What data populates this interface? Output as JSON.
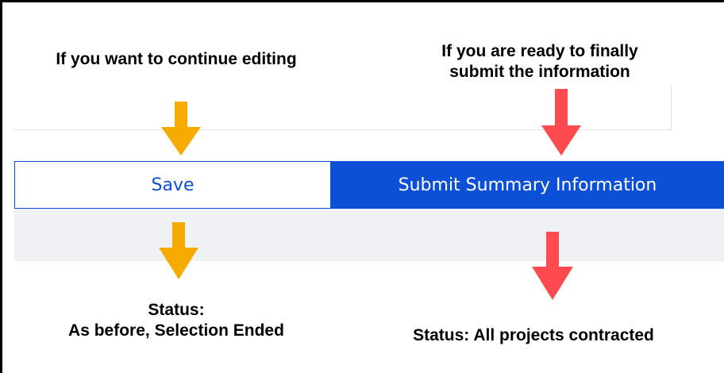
{
  "annotations": {
    "left": "If you want to continue editing",
    "right_line1": "If you are ready to finally",
    "right_line2": "submit the information",
    "status_left_line1": "Status:",
    "status_left_line2": "As before, Selection Ended",
    "status_right": "Status: All projects contracted"
  },
  "buttons": {
    "save_label": "Save",
    "submit_label": "Submit Summary Information"
  },
  "colors": {
    "brand_blue": "#0b50d6",
    "arrow_orange": "#f6ab00",
    "arrow_red": "#ff4b4f",
    "band_gray": "#f0f1f5"
  },
  "icons": {
    "left_arrows": "arrow-down-icon",
    "right_arrows": "arrow-down-icon"
  }
}
